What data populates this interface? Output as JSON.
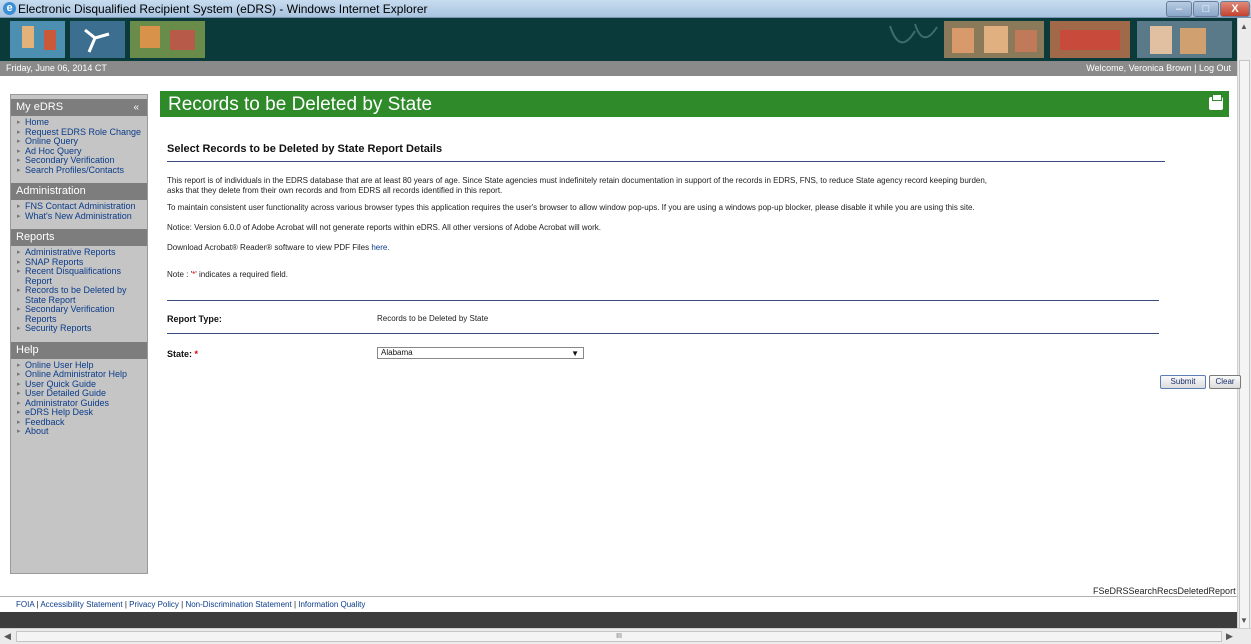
{
  "window": {
    "title": "Electronic Disqualified Recipient System (eDRS) - Windows Internet Explorer",
    "min_glyph": "–",
    "max_glyph": "□",
    "close_glyph": "X"
  },
  "datebar": {
    "date": "Friday, June 06, 2014 CT",
    "welcome": "Welcome, Veronica Brown | Log Out"
  },
  "sidebar": {
    "sections": [
      {
        "title": "My eDRS",
        "items": [
          "Home",
          "Request EDRS Role Change",
          "Online Query",
          "Ad Hoc Query",
          "Secondary Verification",
          "Search Profiles/Contacts"
        ]
      },
      {
        "title": "Administration",
        "items": [
          "FNS Contact Administration",
          "What's New Administration"
        ]
      },
      {
        "title": "Reports",
        "items": [
          "Administrative Reports",
          "SNAP Reports",
          "Recent Disqualifications Report",
          "Records to be Deleted by State Report",
          "Secondary Verification Reports",
          "Security Reports"
        ]
      },
      {
        "title": "Help",
        "items": [
          "Online User Help",
          "Online Administrator Help",
          "User Quick Guide",
          "User Detailed Guide",
          "Administrator Guides",
          "eDRS Help Desk",
          "Feedback",
          "About"
        ]
      }
    ],
    "collapse_glyph": "«"
  },
  "main": {
    "page_title": "Records to be Deleted by State",
    "subtitle": "Select Records to be Deleted by State Report Details",
    "para1_line1": "This report is of individuals in the EDRS database that are at least 80 years of age. Since State agencies must indefinitely retain documentation in support of the records in EDRS, FNS, to reduce State agency record keeping burden,",
    "para1_line2": "asks that they delete from their own records and from EDRS all records identified in this report.",
    "para2": "To maintain consistent user functionality across various browser types this application requires the user's browser to allow window pop-ups. If you are using a windows pop-up blocker, please disable it while you are using this site.",
    "notice": "Notice: Version 6.0.0 of Adobe Acrobat will not generate reports within eDRS. All other versions of Adobe Acrobat will work.",
    "download_text": "Download Acrobat® Reader® software to view PDF Files ",
    "download_link": "here.",
    "note_prefix": "Note : '",
    "note_star": "*",
    "note_suffix": "' indicates a required field.",
    "report_type_label": "Report Type:",
    "report_type_value": "Records to be Deleted by State",
    "state_label": "State:",
    "state_required": "*",
    "state_value": "Alabama",
    "submit_label": "Submit",
    "clear_label": "Clear",
    "page_id": "FSeDRSSearchRecsDeletedReport"
  },
  "footer": {
    "links": [
      "FOIA",
      "Accessibility Statement",
      "Privacy Policy",
      "Non-Discrimination Statement",
      "Information Quality"
    ]
  },
  "colors": {
    "header_green": "#2f8a2a",
    "sidebar_gray": "#c5c5c5",
    "banner_dark": "#0a3a3a"
  }
}
